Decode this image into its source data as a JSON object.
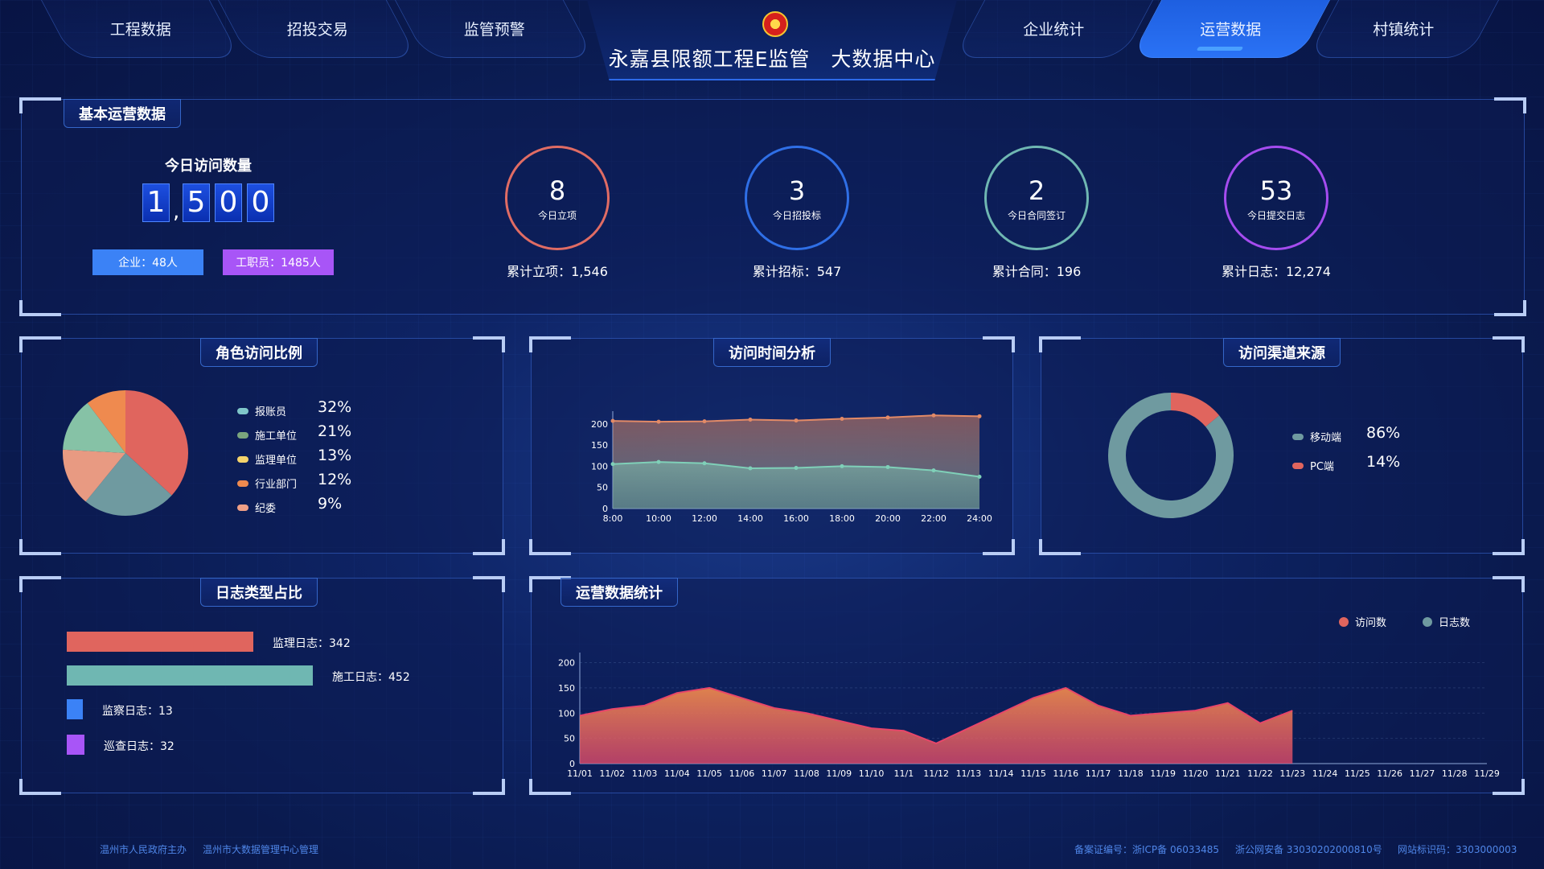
{
  "nav": {
    "left": [
      "工程数据",
      "招投交易",
      "监管预警"
    ],
    "right": [
      "企业统计",
      "运营数据",
      "村镇统计"
    ],
    "active": "运营数据"
  },
  "title": "永嘉县限额工程E监管　大数据中心",
  "basic": {
    "title": "基本运营数据",
    "visit_label": "今日访问数量",
    "digits": [
      "1",
      "5",
      "0",
      "0"
    ],
    "comma": ",",
    "tags": [
      {
        "text": "企业：48人",
        "color": "#3b82f6"
      },
      {
        "text": "工职员：1485人",
        "color": "#a855f7"
      }
    ],
    "rings": [
      {
        "num": "8",
        "label": "今日立项",
        "caption": "累计立项：1,546",
        "color": "#e06c64"
      },
      {
        "num": "3",
        "label": "今日招投标",
        "caption": "累计招标：547",
        "color": "#2f6fe6"
      },
      {
        "num": "2",
        "label": "今日合同签订",
        "caption": "累计合同：196",
        "color": "#6fb7b2"
      },
      {
        "num": "53",
        "label": "今日提交日志",
        "caption": "累计日志：12,274",
        "color": "#a54cef"
      }
    ]
  },
  "role_panel": {
    "title": "角色访问比例",
    "items": [
      {
        "name": "报账员",
        "pct": "32%",
        "value": 32,
        "color": "#7fc6c9"
      },
      {
        "name": "施工单位",
        "pct": "21%",
        "value": 21,
        "color": "#7aa57d"
      },
      {
        "name": "监理单位",
        "pct": "13%",
        "value": 13,
        "color": "#f4d36b"
      },
      {
        "name": "行业部门",
        "pct": "12%",
        "value": 12,
        "color": "#ef8a4f"
      },
      {
        "name": "纪委",
        "pct": "9%",
        "value": 9,
        "color": "#ef9f86"
      }
    ]
  },
  "time_panel": {
    "title": "访问时间分析"
  },
  "channel_panel": {
    "title": "访问渠道来源",
    "items": [
      {
        "name": "移动端",
        "pct": "86%",
        "value": 86,
        "color": "#6f9aa0"
      },
      {
        "name": "PC端",
        "pct": "14%",
        "value": 14,
        "color": "#e0655e"
      }
    ]
  },
  "log_panel": {
    "title": "日志类型占比",
    "items": [
      {
        "label": "监理日志：342",
        "value": 342,
        "color": "#e0655e"
      },
      {
        "label": "施工日志：452",
        "value": 452,
        "color": "#6fb7b2"
      },
      {
        "label": "监察日志：13",
        "value": 13,
        "color": "#3b82f6"
      },
      {
        "label": "巡查日志：32",
        "value": 32,
        "color": "#a855f7"
      }
    ]
  },
  "ops_panel": {
    "title": "运营数据统计",
    "legend": [
      {
        "name": "访问数",
        "color": "#e0655e"
      },
      {
        "name": "日志数",
        "color": "#6f9aa0"
      }
    ]
  },
  "chart_data": [
    {
      "type": "area",
      "x": [
        "8:00",
        "10:00",
        "12:00",
        "14:00",
        "16:00",
        "18:00",
        "20:00",
        "22:00",
        "24:00"
      ],
      "y_ticks": [
        0,
        50,
        100,
        150,
        200
      ],
      "ylim": [
        0,
        230
      ],
      "series": [
        {
          "values": [
            207,
            205,
            206,
            210,
            208,
            212,
            215,
            220,
            218
          ],
          "color": "#e0906e"
        },
        {
          "values": [
            105,
            110,
            107,
            95,
            96,
            100,
            98,
            90,
            75
          ],
          "color": "#7fc6b3"
        }
      ]
    },
    {
      "type": "area",
      "x": [
        "11/01",
        "11/02",
        "11/03",
        "11/04",
        "11/05",
        "11/06",
        "11/07",
        "11/08",
        "11/09",
        "11/10",
        "11/1",
        "11/12",
        "11/13",
        "11/14",
        "11/15",
        "11/16",
        "11/17",
        "11/18",
        "11/19",
        "11/20",
        "11/21",
        "11/22",
        "11/23",
        "11/24",
        "11/25",
        "11/26",
        "11/27",
        "11/28",
        "11/29"
      ],
      "y_ticks": [
        0,
        50,
        100,
        150,
        200
      ],
      "ylim": [
        0,
        220
      ],
      "series": [
        {
          "name": "访问数",
          "values": [
            95,
            108,
            115,
            140,
            150,
            130,
            110,
            100,
            85,
            70,
            65,
            40,
            70,
            100,
            130,
            150,
            115,
            95,
            100,
            105,
            120,
            80,
            105,
            null,
            null,
            null,
            null,
            null,
            null
          ],
          "color": "#e0655e"
        }
      ]
    }
  ],
  "footer": {
    "left": [
      "温州市人民政府主办",
      "温州市大数据管理中心管理"
    ],
    "right": [
      "备案证编号：浙ICP备 06033485",
      "浙公网安备 33030202000810号",
      "网站标识码：3303000003"
    ]
  }
}
